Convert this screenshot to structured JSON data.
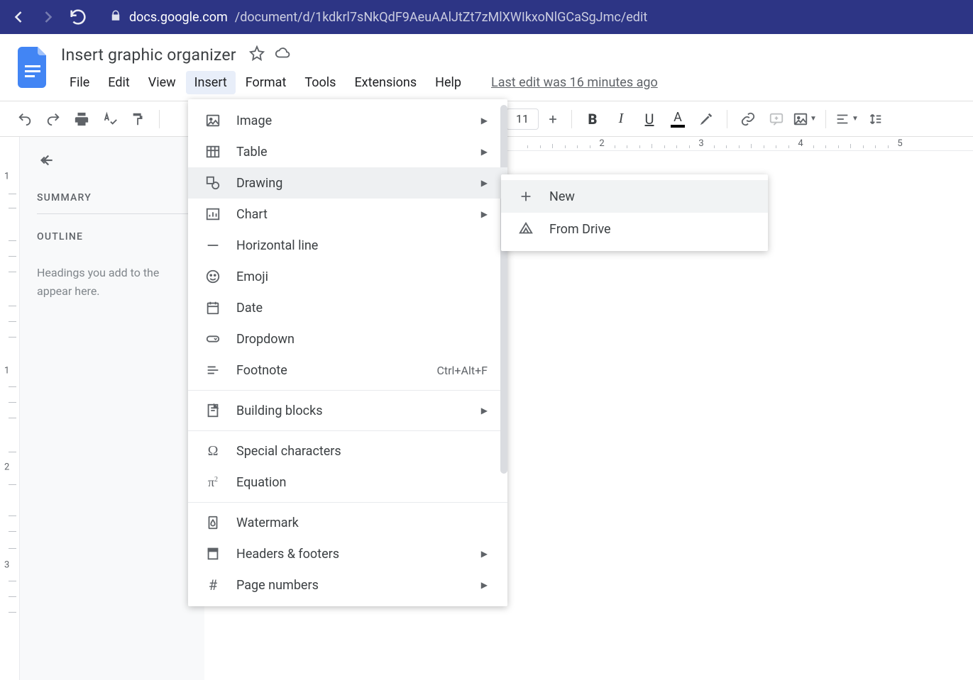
{
  "browser": {
    "url_host": "docs.google.com",
    "url_path": "/document/d/1kdkrl7sNkQdF9AeuAAlJtZt7zMlXWIkxoNlGCaSgJmc/edit"
  },
  "header": {
    "title": "Insert graphic organizer",
    "last_edit": "Last edit was 16 minutes ago"
  },
  "menubar": {
    "file": "File",
    "edit": "Edit",
    "view": "View",
    "insert": "Insert",
    "format": "Format",
    "tools": "Tools",
    "extensions": "Extensions",
    "help": "Help"
  },
  "toolbar": {
    "font_size": "11"
  },
  "sidebar": {
    "summary": "SUMMARY",
    "outline": "OUTLINE",
    "outline_placeholder": "Headings you add to the  appear here."
  },
  "ruler": {
    "h": [
      "2",
      "3",
      "4",
      "5"
    ]
  },
  "insert_menu": {
    "image": "Image",
    "table": "Table",
    "drawing": "Drawing",
    "chart": "Chart",
    "horizontal_line": "Horizontal line",
    "emoji": "Emoji",
    "date": "Date",
    "dropdown": "Dropdown",
    "footnote": "Footnote",
    "footnote_shortcut": "Ctrl+Alt+F",
    "building_blocks": "Building blocks",
    "special_chars": "Special characters",
    "equation": "Equation",
    "watermark": "Watermark",
    "headers_footers": "Headers & footers",
    "page_numbers": "Page numbers"
  },
  "drawing_submenu": {
    "new": "New",
    "from_drive": "From Drive"
  }
}
